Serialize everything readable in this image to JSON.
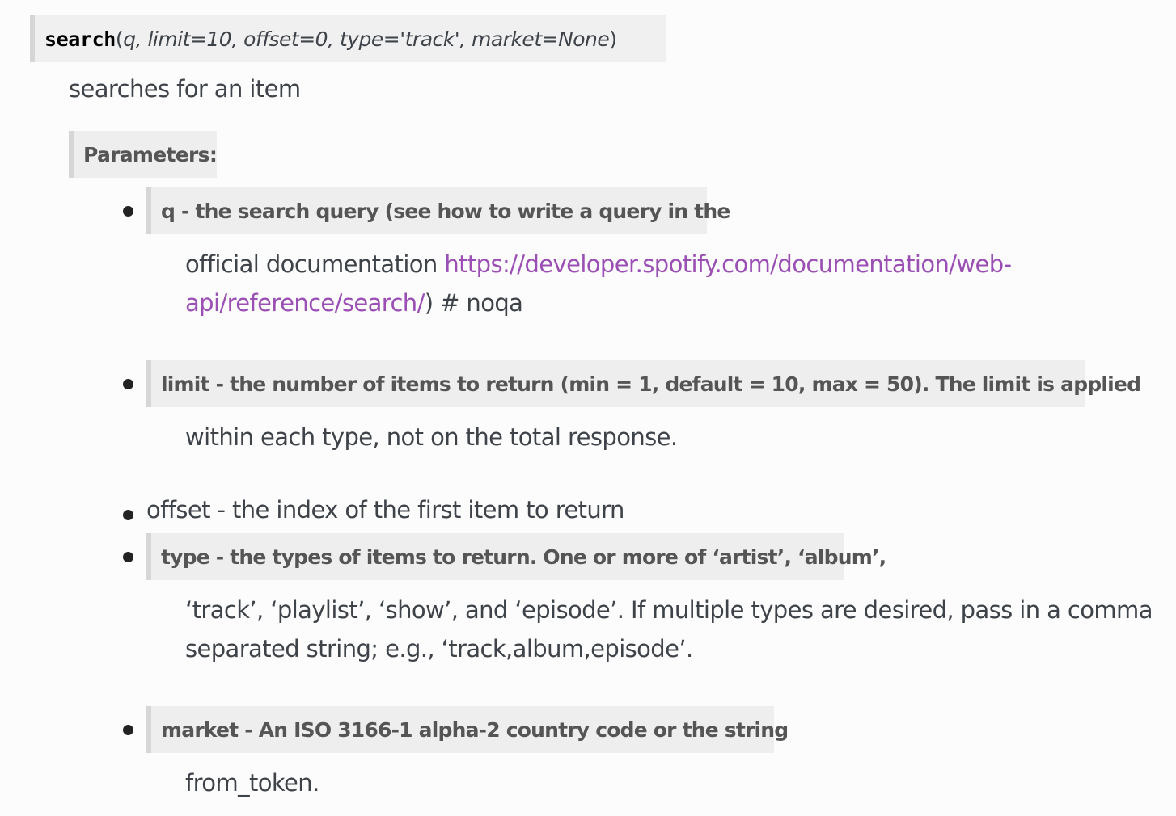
{
  "signature": {
    "name": "search",
    "open_paren": "(",
    "args": "q, limit=10, offset=0, type='track', market=None",
    "close_paren": ")"
  },
  "description": "searches for an item",
  "parameters_label": "Parameters:",
  "params": {
    "q": {
      "term": "q - the search query (see how to write a query in the",
      "line1_text": "official documentation ",
      "link_part1": "https://developer.spotify.com/documentation/web-",
      "link_part2": "api/reference/search/",
      "line2_tail": ") # noqa"
    },
    "limit": {
      "term": "limit - the number of items to return (min = 1, default = 10, max = 50). The limit is applied",
      "line1": "within each type, not on the total response."
    },
    "offset": {
      "text": "offset - the index of the first item to return"
    },
    "type": {
      "term": "type - the types of items to return. One or more of ‘artist’, ‘album’,",
      "line1": "‘track’, ‘playlist’, ‘show’, and ‘episode’. If multiple types are desired, pass in a comma",
      "line2": "separated string; e.g., ‘track,album,episode’."
    },
    "market": {
      "term": "market - An ISO 3166-1 alpha-2 country code or the string",
      "line1": "from_token."
    }
  }
}
